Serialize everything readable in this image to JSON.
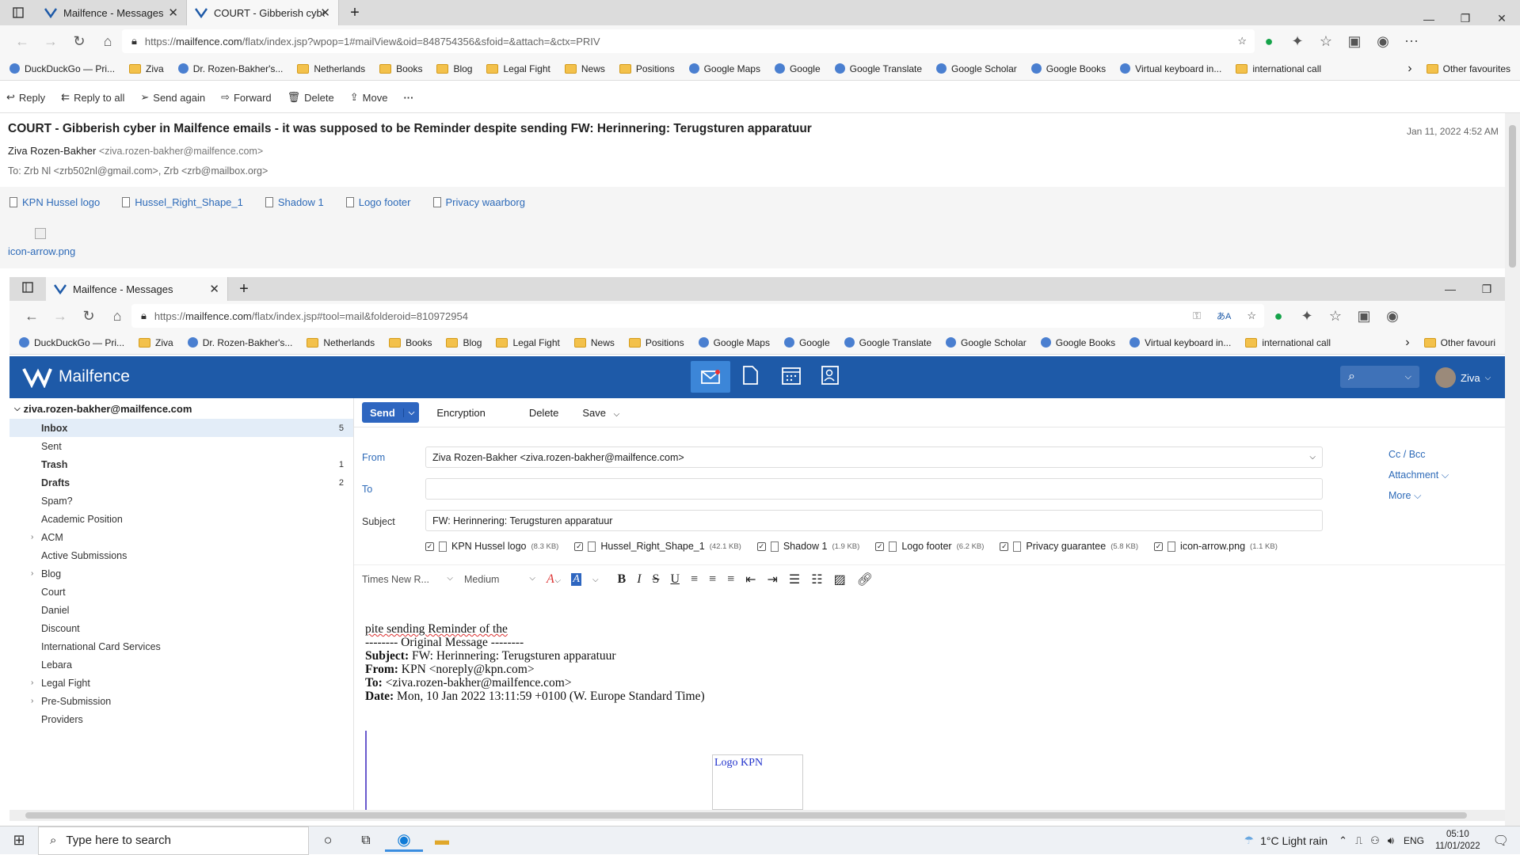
{
  "outer": {
    "tabs": [
      {
        "title": "Mailfence - Messages"
      },
      {
        "title": "COURT - Gibberish cyber in Mail"
      }
    ],
    "url_prefix": "https://",
    "url_host": "mailfence.com",
    "url_rest": "/flatx/index.jsp?wpop=1#mailView&oid=848754356&sfoid=&attach=&ctx=PRIV",
    "bookmarks": [
      "DuckDuckGo — Pri...",
      "Ziva",
      "Dr. Rozen-Bakher's...",
      "Netherlands",
      "Books",
      "Blog",
      "Legal Fight",
      "News",
      "Positions",
      "Google Maps",
      "Google",
      "Google Translate",
      "Google Scholar",
      "Google Books",
      "Virtual keyboard in...",
      "international call"
    ],
    "other_favourites": "Other favourites",
    "actions": [
      "Reply",
      "Reply to all",
      "Send again",
      "Forward",
      "Delete",
      "Move"
    ],
    "more": "···",
    "subject": "COURT - Gibberish cyber in Mailfence emails - it was supposed to be Reminder despite sending FW: Herinnering: Terugsturen apparatuur",
    "date": "Jan 11, 2022 4:52 AM",
    "from_name": "Ziva Rozen-Bakher",
    "from_email": "<ziva.rozen-bakher@mailfence.com>",
    "to": "To: Zrb Nl <zrb502nl@gmail.com>, Zrb <zrb@mailbox.org>",
    "attachments": [
      "KPN Hussel logo",
      "Hussel_Right_Shape_1",
      "Shadow 1",
      "Logo footer",
      "Privacy waarborg"
    ],
    "image_link": "icon-arrow.png"
  },
  "inner": {
    "tab_title": "Mailfence - Messages",
    "url_prefix": "https://",
    "url_host": "mailfence.com",
    "url_rest": "/flatx/index.jsp#tool=mail&folderoid=810972954",
    "bookmarks": [
      "DuckDuckGo — Pri...",
      "Ziva",
      "Dr. Rozen-Bakher's...",
      "Netherlands",
      "Books",
      "Blog",
      "Legal Fight",
      "News",
      "Positions",
      "Google Maps",
      "Google",
      "Google Translate",
      "Google Scholar",
      "Google Books",
      "Virtual keyboard in...",
      "international call"
    ],
    "other_favourites": "Other favouri",
    "brand": "Mailfence",
    "user": "Ziva",
    "account": "ziva.rozen-bakher@mailfence.com",
    "folders": [
      {
        "label": "Inbox",
        "count": "5",
        "bold": true,
        "expand": false
      },
      {
        "label": "Sent",
        "count": "",
        "bold": false,
        "expand": false
      },
      {
        "label": "Trash",
        "count": "1",
        "bold": true,
        "expand": false
      },
      {
        "label": "Drafts",
        "count": "2",
        "bold": true,
        "expand": false
      },
      {
        "label": "Spam?",
        "count": "",
        "bold": false,
        "expand": false
      },
      {
        "label": "Academic Position",
        "count": "",
        "bold": false,
        "expand": false
      },
      {
        "label": "ACM",
        "count": "",
        "bold": false,
        "expand": true
      },
      {
        "label": "Active Submissions",
        "count": "",
        "bold": false,
        "expand": false
      },
      {
        "label": "Blog",
        "count": "",
        "bold": false,
        "expand": true
      },
      {
        "label": "Court",
        "count": "",
        "bold": false,
        "expand": false
      },
      {
        "label": "Daniel",
        "count": "",
        "bold": false,
        "expand": false
      },
      {
        "label": "Discount",
        "count": "",
        "bold": false,
        "expand": false
      },
      {
        "label": "International Card Services",
        "count": "",
        "bold": false,
        "expand": false
      },
      {
        "label": "Lebara",
        "count": "",
        "bold": false,
        "expand": false
      },
      {
        "label": "Legal Fight",
        "count": "",
        "bold": false,
        "expand": true
      },
      {
        "label": "Pre-Submission",
        "count": "",
        "bold": false,
        "expand": true
      },
      {
        "label": "Providers",
        "count": "",
        "bold": false,
        "expand": false
      }
    ],
    "compose": {
      "send": "Send",
      "encryption": "Encryption",
      "delete": "Delete",
      "save": "Save",
      "from_label": "From",
      "from_value": "Ziva Rozen-Bakher <ziva.rozen-bakher@mailfence.com>",
      "to_label": "To",
      "to_value": "",
      "subject_label": "Subject",
      "subject_value": "FW: Herinnering: Terugsturen apparatuur",
      "cc_bcc": "Cc / Bcc",
      "attachment": "Attachment",
      "more": "More",
      "attachments": [
        {
          "name": "KPN Hussel logo",
          "size": "(8.3 KB)"
        },
        {
          "name": "Hussel_Right_Shape_1",
          "size": "(42.1 KB)"
        },
        {
          "name": "Shadow 1",
          "size": "(1.9 KB)"
        },
        {
          "name": "Logo footer",
          "size": "(6.2 KB)"
        },
        {
          "name": "Privacy guarantee",
          "size": "(5.8 KB)"
        },
        {
          "name": "icon-arrow.png",
          "size": "(1.1 KB)"
        }
      ],
      "font_family": "Times New R...",
      "font_size": "Medium",
      "body_line1": "pite  sending Reminder of the",
      "body_orig": "-------- Original Message --------",
      "hdr_subject_label": "Subject:",
      "hdr_subject": "FW: Herinnering: Terugsturen apparatuur",
      "hdr_from_label": "From:",
      "hdr_from": "KPN <noreply@kpn.com>",
      "hdr_to_label": "To:",
      "hdr_to": "<ziva.rozen-bakher@mailfence.com>",
      "hdr_date_label": "Date:",
      "hdr_date": "Mon, 10 Jan 2022 13:11:59 +0100 (W. Europe Standard Time)",
      "logo_alt": "Logo KPN"
    }
  },
  "taskbar": {
    "search_placeholder": "Type here to search",
    "weather": "1°C  Light rain",
    "lang": "ENG",
    "time": "05:10",
    "date": "11/01/2022"
  }
}
